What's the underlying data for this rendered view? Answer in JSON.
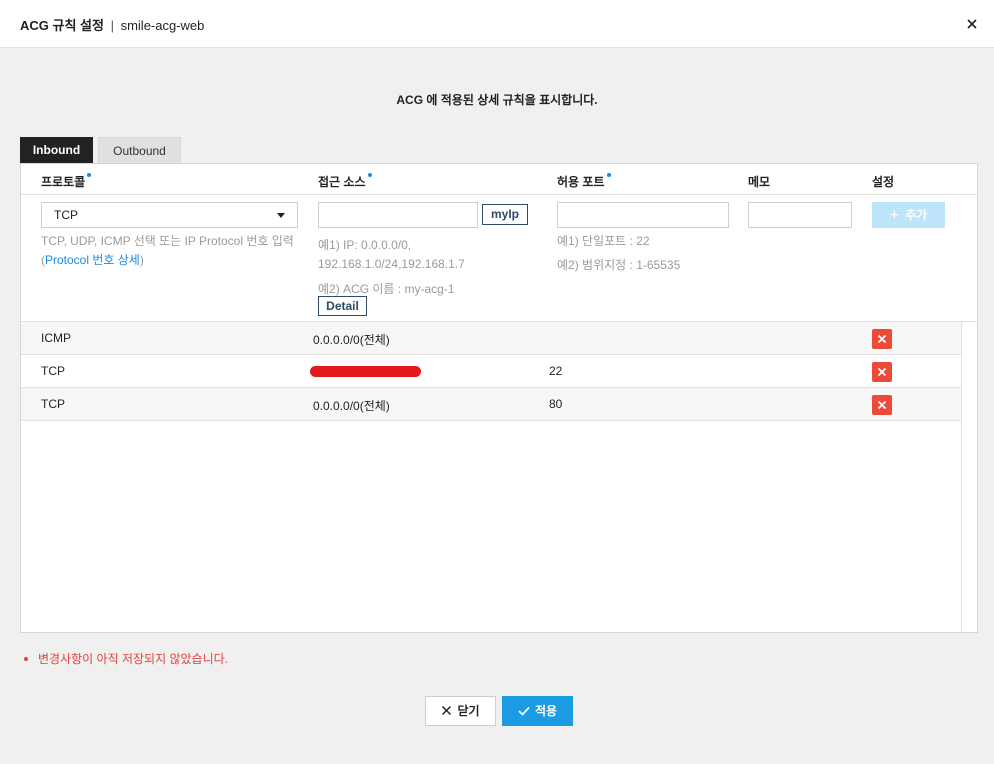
{
  "header": {
    "title": "ACG 규칙 설정",
    "separator": "|",
    "acg_name": "smile-acg-web"
  },
  "description": "ACG 에 적용된 상세 규칙을 표시합니다.",
  "tabs": [
    {
      "label": "Inbound",
      "active": true
    },
    {
      "label": "Outbound",
      "active": false
    }
  ],
  "columns": {
    "protocol": "프로토콜",
    "source": "접근 소스",
    "port": "허용 포트",
    "memo": "메모",
    "setting": "설정"
  },
  "form": {
    "protocol_value": "TCP",
    "protocol_hint": "TCP, UDP, ICMP 선택 또는 IP Protocol 번호 입력",
    "protocol_link_open": "(",
    "protocol_link": "Protocol 번호 상세",
    "protocol_link_close": ")",
    "source_value": "",
    "myip_label": "myIp",
    "source_hint_1a": "예1) IP: 0.0.0.0/0,",
    "source_hint_1b": "192.168.1.0/24,192.168.1.7",
    "source_hint_2": "예2) ACG 이름 : my-acg-1",
    "detail_label": "Detail",
    "port_value": "",
    "port_hint_1": "예1) 단일포트 : 22",
    "port_hint_2": "예2) 범위지정 : 1-65535",
    "memo_value": "",
    "add_icon": "+",
    "add_label": "추가"
  },
  "rules": [
    {
      "protocol": "ICMP",
      "source": "0.0.0.0/0(전체)",
      "source_redacted": false,
      "port": ""
    },
    {
      "protocol": "TCP",
      "source": "",
      "source_redacted": true,
      "port": "22"
    },
    {
      "protocol": "TCP",
      "source": "0.0.0.0/0(전체)",
      "source_redacted": false,
      "port": "80"
    }
  ],
  "warning": "변경사항이 아직 저장되지 않았습니다.",
  "footer": {
    "close_label": "닫기",
    "apply_label": "적용"
  },
  "colors": {
    "accent": "#1a9be2",
    "delete": "#ed4a3a",
    "warning": "#e0433c",
    "active_tab": "#222222",
    "redaction": "#e3191b"
  }
}
